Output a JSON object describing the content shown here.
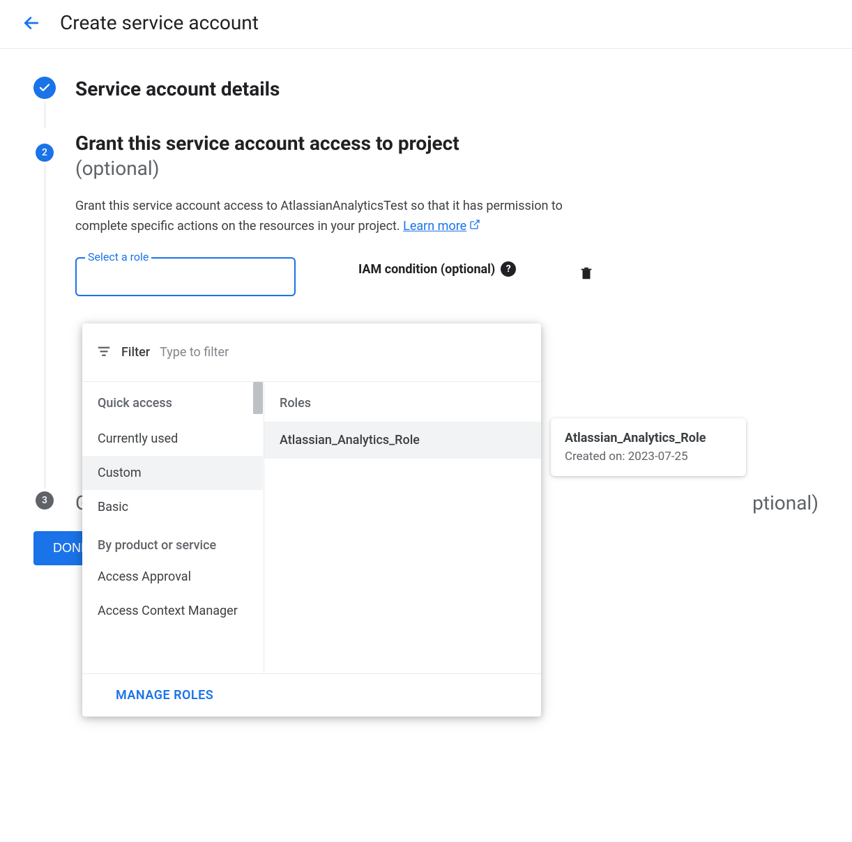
{
  "header": {
    "title": "Create service account"
  },
  "steps": {
    "step1": {
      "title": "Service account details"
    },
    "step2": {
      "number": "2",
      "title": "Grant this service account access to project",
      "optional": "(optional)",
      "description_part1": "Grant this service account access to AtlassianAnalyticsTest so that it has permission to complete specific actions on the resources in your project. ",
      "learn_more": "Learn more",
      "role_label": "Select a role",
      "iam_condition_label": "IAM condition (optional)"
    },
    "step3": {
      "number": "3",
      "title_prefix": "G",
      "title_suffix": "ptional)"
    }
  },
  "dropdown": {
    "filter_label": "Filter",
    "filter_placeholder": "Type to filter",
    "quick_access_label": "Quick access",
    "items_quick": [
      "Currently used",
      "Custom",
      "Basic"
    ],
    "by_product_label": "By product or service",
    "items_product": [
      "Access Approval",
      "Access Context Manager"
    ],
    "roles_label": "Roles",
    "roles_items": [
      "Atlassian_Analytics_Role"
    ],
    "manage_roles": "MANAGE ROLES"
  },
  "tooltip": {
    "title": "Atlassian_Analytics_Role",
    "created": "Created on: 2023-07-25"
  },
  "buttons": {
    "done": "DONE"
  }
}
